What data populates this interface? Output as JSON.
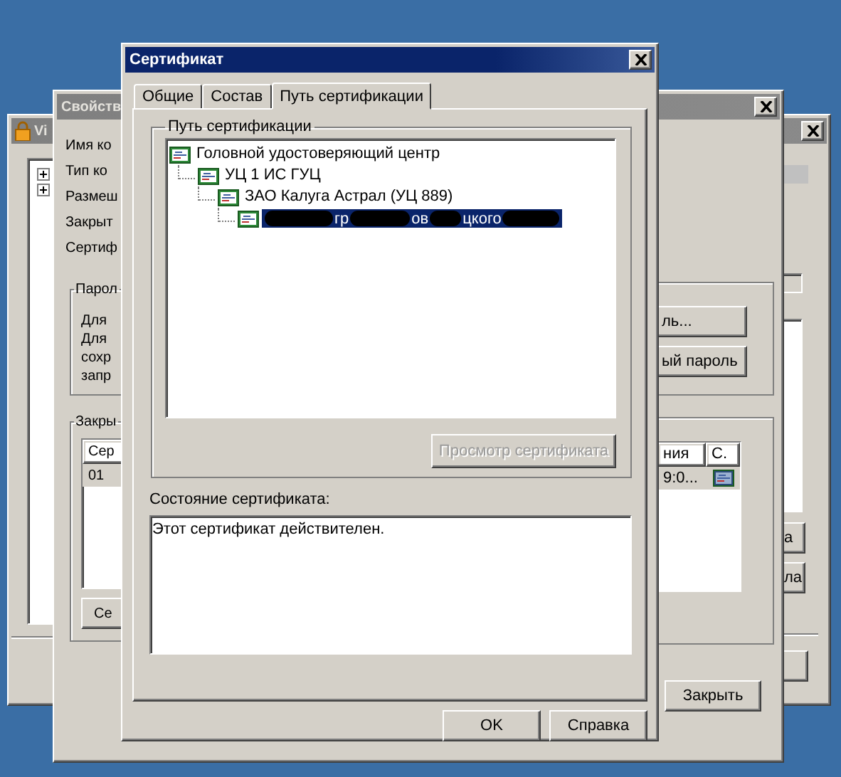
{
  "app_window": {
    "title": "Vi",
    "active": false,
    "tree": [
      {
        "expanded": false
      },
      {
        "expanded": false
      }
    ],
    "right_buttons": [
      "а",
      "ла"
    ]
  },
  "properties_window": {
    "title": "Свойств",
    "active": false,
    "fields": [
      "Имя ко",
      "Тип ко",
      "Размеш",
      "Закрыт",
      "Сертиф"
    ],
    "password_group": {
      "title": "Парол",
      "lines": [
        "Для",
        "Для",
        "сохр",
        "запр"
      ],
      "buttons": [
        "ль...",
        "ый пароль"
      ]
    },
    "keys_group": {
      "title": "Закры",
      "columns": [
        "Сер",
        "ния",
        "С."
      ],
      "rows": [
        {
          "cells": [
            "01",
            "9:0..."
          ],
          "selected": true
        }
      ],
      "button": "Се"
    },
    "close_button": "Закрыть"
  },
  "certificate_dialog": {
    "title": "Сертификат",
    "active": true,
    "tabs": [
      {
        "label": "Общие",
        "selected": false
      },
      {
        "label": "Состав",
        "selected": false
      },
      {
        "label": "Путь сертификации",
        "selected": true
      }
    ],
    "path_group": {
      "title": "Путь сертификации",
      "tree": [
        {
          "label": "Головной удостоверяющий центр",
          "selected": false,
          "children": [
            {
              "label": "УЦ 1 ИС ГУЦ",
              "selected": false,
              "children": [
                {
                  "label": "ЗАО Калуга Астрал (УЦ 889)",
                  "selected": false,
                  "children": [
                    {
                      "kind": "redacted",
                      "segments": [
                        "гр",
                        "ов",
                        "цкого"
                      ],
                      "selected": true
                    }
                  ]
                }
              ]
            }
          ]
        }
      ]
    },
    "view_button": {
      "label": "Просмотр сертификата",
      "disabled": true
    },
    "status_label": "Состояние сертификата:",
    "status_text": "Этот сертификат действителен.",
    "buttons": [
      "OK",
      "Справка"
    ]
  }
}
